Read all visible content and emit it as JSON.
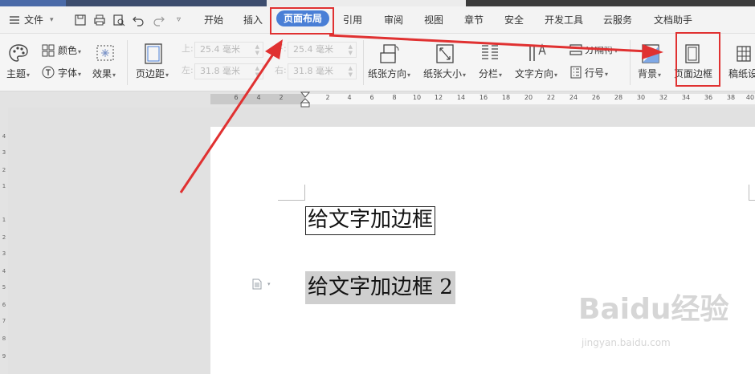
{
  "menu": {
    "file": "文件",
    "tabs": [
      "开始",
      "插入",
      "页面布局",
      "引用",
      "审阅",
      "视图",
      "章节",
      "安全",
      "开发工具",
      "云服务",
      "文档助手"
    ],
    "active_tab": "页面布局"
  },
  "ribbon": {
    "theme": "主题",
    "colors": "颜色",
    "fonts": "字体",
    "effects": "效果",
    "margins": "页边距",
    "margin_top_label": "上:",
    "margin_top_value": "25.4 毫米",
    "margin_bottom_label": "下:",
    "margin_bottom_value": "25.4 毫米",
    "margin_left_label": "左:",
    "margin_left_value": "31.8 毫米",
    "margin_right_label": "右:",
    "margin_right_value": "31.8 毫米",
    "orientation": "纸张方向",
    "size": "纸张大小",
    "columns": "分栏",
    "text_direction": "文字方向",
    "hyphenation": "分隔符",
    "line_numbers": "行号",
    "background": "背景",
    "page_borders": "页面边框",
    "draft_paper": "稿纸设"
  },
  "ruler": {
    "left_ticks": [
      "6",
      "4",
      "2"
    ],
    "right_ticks": [
      "2",
      "4",
      "6",
      "8",
      "10",
      "12",
      "14",
      "16",
      "18",
      "20",
      "22",
      "24",
      "26",
      "28",
      "30",
      "32",
      "34",
      "36",
      "38",
      "40"
    ],
    "vertical_ticks": [
      "4",
      "3",
      "2",
      "1",
      "1",
      "2",
      "3",
      "4",
      "5",
      "6",
      "7",
      "8",
      "9"
    ]
  },
  "document": {
    "line1": "给文字加边框",
    "line2": "给文字加边框 2"
  },
  "watermark": {
    "brand": "Baidu经验",
    "url": "jingyan.baidu.com"
  },
  "colors": {
    "accent": "#4a7fd6",
    "annotation": "#e03131"
  }
}
